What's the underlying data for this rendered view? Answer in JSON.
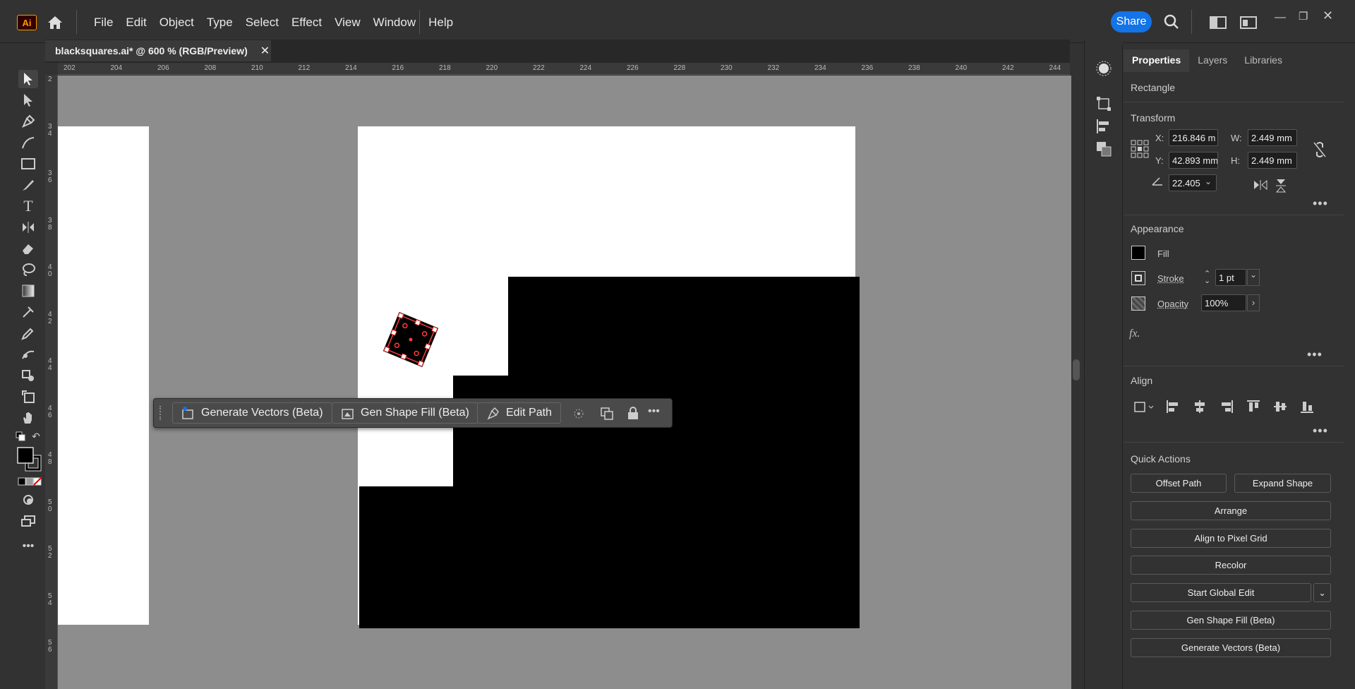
{
  "app": {
    "logo": "Ai",
    "share_label": "Share"
  },
  "menu": [
    "File",
    "Edit",
    "Object",
    "Type",
    "Select",
    "Effect",
    "View",
    "Window",
    "Help"
  ],
  "document": {
    "tab_title": "blacksquares.ai* @ 600 % (RGB/Preview)",
    "close": "✕"
  },
  "ruler": {
    "top_ticks": [
      "202",
      "204",
      "206",
      "208",
      "210",
      "212",
      "214",
      "216",
      "218",
      "220",
      "222",
      "224",
      "226",
      "228",
      "230",
      "232",
      "234",
      "236",
      "238",
      "240",
      "242",
      "244"
    ],
    "left_ticks": [
      "2",
      "3 4",
      "3 6",
      "3 8",
      "4 0",
      "4 2",
      "4 4",
      "4 6",
      "4 8",
      "5 0",
      "5 2",
      "5 4",
      "5 6"
    ]
  },
  "context_bar": {
    "generate_vectors": "Generate Vectors (Beta)",
    "gen_shape_fill": "Gen Shape Fill (Beta)",
    "edit_path": "Edit Path",
    "more": "•••"
  },
  "panel": {
    "tabs": [
      "Properties",
      "Layers",
      "Libraries"
    ],
    "selection_type": "Rectangle",
    "transform": {
      "title": "Transform",
      "x_label": "X:",
      "x_value": "216.846 m",
      "y_label": "Y:",
      "y_value": "42.893 mm",
      "w_label": "W:",
      "w_value": "2.449 mm",
      "h_label": "H:",
      "h_value": "2.449 mm",
      "angle_value": "22.405"
    },
    "appearance": {
      "title": "Appearance",
      "fill_label": "Fill",
      "stroke_label": "Stroke",
      "stroke_value": "1 pt",
      "opacity_label": "Opacity",
      "opacity_value": "100%",
      "fx_label": "fx."
    },
    "align": {
      "title": "Align"
    },
    "quick_actions": {
      "title": "Quick Actions",
      "offset_path": "Offset Path",
      "expand_shape": "Expand Shape",
      "arrange": "Arrange",
      "align_pixel": "Align to Pixel Grid",
      "recolor": "Recolor",
      "start_global_edit": "Start Global Edit",
      "gen_shape_fill": "Gen Shape Fill (Beta)",
      "generate_vectors": "Generate Vectors (Beta)"
    },
    "more": "•••"
  },
  "colors": {
    "accent": "#1473e6",
    "canvas": "#8d8d8d",
    "panel": "#323232",
    "selection": "#ff3b3b"
  }
}
